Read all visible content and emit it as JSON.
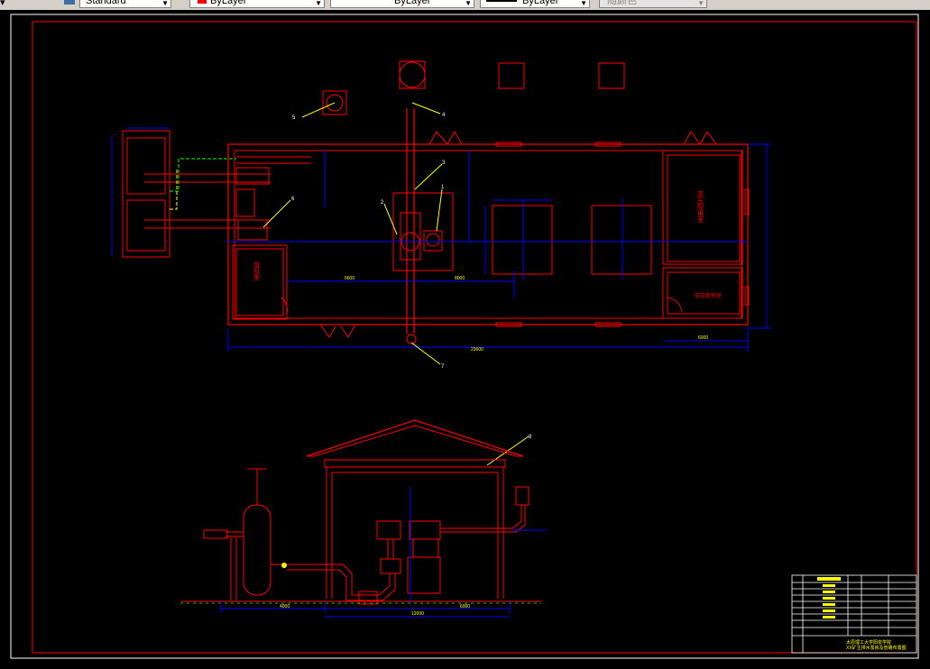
{
  "toolbar": {
    "textstyle_label": "Standard",
    "color_label": "ByLayer",
    "linetype_label": "ByLayer",
    "lineweight_label": "ByLayer",
    "plotstyle_label": "随颜色"
  },
  "drawing": {
    "plan_dims": {
      "total_width": "23600",
      "right_room": "6000",
      "left_offset": "6600",
      "pump_dim": "8000"
    },
    "plan_labels": {
      "left_room": "值班室",
      "right_room_top": "高压配电室",
      "right_room_bottom": "低压配电室"
    },
    "callouts": [
      "1",
      "2",
      "3",
      "4",
      "5",
      "6",
      "7",
      "8"
    ],
    "section_dims": {
      "left": "4000",
      "mid": "12000",
      "right": "6000"
    },
    "title_block": {
      "school": "太原理工大学阳泉学院",
      "drawing_title": "XX矿主排水泵房及管路布置图"
    }
  },
  "colors": {
    "line_red": "#ff0000",
    "dim_blue": "#0000ff",
    "text_yellow": "#ffff00",
    "text_white": "#ffffff",
    "green": "#00ff00"
  }
}
